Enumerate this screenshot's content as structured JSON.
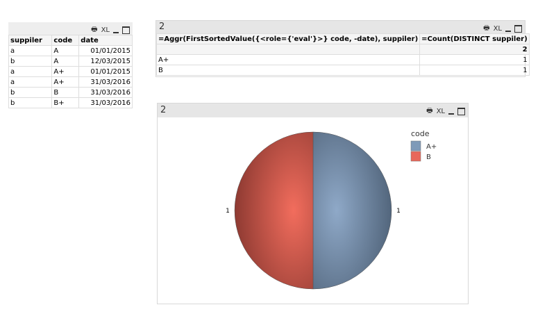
{
  "table_box": {
    "icons": [
      "print-icon",
      "xl-icon",
      "minimize-icon",
      "maximize-icon"
    ],
    "xl_label": "XL",
    "headers": [
      "suppiler",
      "code",
      "date"
    ],
    "rows": [
      [
        "a",
        "A",
        "01/01/2015"
      ],
      [
        "b",
        "A",
        "12/03/2015"
      ],
      [
        "a",
        "A+",
        "01/01/2015"
      ],
      [
        "a",
        "A+",
        "31/03/2016"
      ],
      [
        "b",
        "B",
        "31/03/2016"
      ],
      [
        "b",
        "B+",
        "31/03/2016"
      ]
    ]
  },
  "straight_table": {
    "title": "2",
    "xl_label": "XL",
    "headers": [
      "=Aggr(FirstSortedValue({<role={'eval'}>} code, -date), suppiler)",
      "=Count(DISTINCT suppiler)"
    ],
    "total": [
      "",
      "2"
    ],
    "rows": [
      [
        "A+",
        "1"
      ],
      [
        "B",
        "1"
      ]
    ]
  },
  "pie_box": {
    "title": "2",
    "xl_label": "XL"
  },
  "chart_data": {
    "type": "pie",
    "legend_title": "code",
    "legend_position": "top-right",
    "categories": [
      "A+",
      "B"
    ],
    "values": [
      1,
      1
    ],
    "data_labels": [
      "1",
      "1"
    ],
    "colors": [
      "#7f9ab8",
      "#e8685a"
    ]
  }
}
